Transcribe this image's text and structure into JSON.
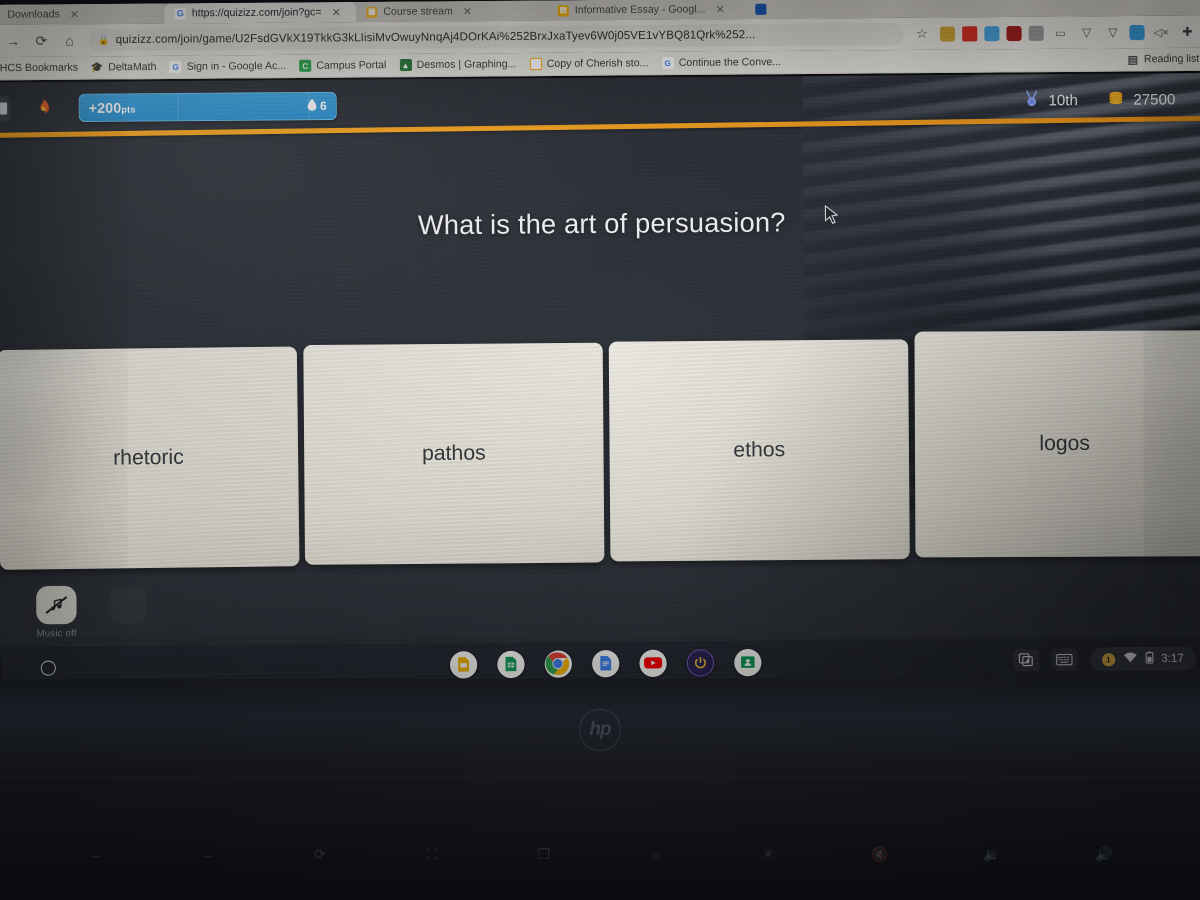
{
  "browser": {
    "tabs": [
      {
        "title": "Downloads",
        "favicon": "downloads-icon",
        "active": false
      },
      {
        "title": "https://quizizz.com/join?gc=",
        "favicon": "google-icon",
        "active": true
      },
      {
        "title": "Course stream",
        "favicon": "classroom-icon",
        "active": false
      },
      {
        "title": "Informative Essay - Googl...",
        "favicon": "docs-icon",
        "active": false
      }
    ],
    "nav": {
      "forward_icon": "arrow-right-icon",
      "reload_icon": "reload-icon",
      "home_icon": "home-icon"
    },
    "address": {
      "lock_icon": "lock-icon",
      "url": "quizizz.com/join/game/U2FsdGVkX19TkkG3kLIisiMvOwuyNnqAj4DOrKAi%252BrxJxaTyev6W0j05VE1vYBQ81Qrk%252...",
      "star_icon": "star-icon"
    },
    "extensions": [
      {
        "name": "extension-1-icon",
        "color": "#c9a227",
        "glyph": ""
      },
      {
        "name": "extension-2-icon",
        "color": "#d93025",
        "glyph": ""
      },
      {
        "name": "extension-3-icon",
        "color": "#4aa3df",
        "glyph": ""
      },
      {
        "name": "extension-4-icon",
        "color": "#a32020",
        "glyph": ""
      },
      {
        "name": "extension-5-icon",
        "color": "#8b8b8b",
        "glyph": ""
      },
      {
        "name": "extension-6-icon",
        "color": "#6e6e6e",
        "glyph": "▭"
      },
      {
        "name": "extension-7-icon",
        "color": "#6e6e6e",
        "glyph": "▽"
      },
      {
        "name": "extension-8-icon",
        "color": "#6e6e6e",
        "glyph": "▽"
      },
      {
        "name": "extension-9-icon",
        "color": "#3a9ad9",
        "glyph": ""
      },
      {
        "name": "mute-tab-icon",
        "color": "#5e5e5e",
        "glyph": "◁×"
      },
      {
        "name": "extensions-puzzle-icon",
        "color": "#4a4a4a",
        "glyph": "✚"
      }
    ],
    "bookmarks": [
      {
        "label": "HCS Bookmarks",
        "icon": "folder-icon",
        "color": "none"
      },
      {
        "label": "DeltaMath",
        "icon": "graduation-cap-icon",
        "color": "#2b2b2b"
      },
      {
        "label": "Sign in - Google Ac...",
        "icon": "google-icon",
        "color": "#ffffff"
      },
      {
        "label": "Campus Portal",
        "icon": "campus-icon",
        "color": "#2fa84f"
      },
      {
        "label": "Desmos | Graphing...",
        "icon": "desmos-icon",
        "color": "#2d7a3e"
      },
      {
        "label": "Copy of Cherish sto...",
        "icon": "slides-icon",
        "color": "#f4b400"
      },
      {
        "label": "Continue the Conve...",
        "icon": "google-icon",
        "color": "#ffffff"
      }
    ],
    "reading_list": {
      "label": "Reading list",
      "icon": "reading-list-icon"
    }
  },
  "quiz": {
    "points_bar": {
      "value": "+200",
      "unit": "pts",
      "streak_icon": "water-drop-icon",
      "streak_count": "6"
    },
    "avatar_icon": "fire-avatar-icon",
    "rank": {
      "icon": "medal-icon",
      "value": "10th"
    },
    "score": {
      "icon": "coin-stack-icon",
      "value": "27500"
    },
    "question": "What is the art of persuasion?",
    "answers": [
      {
        "label": "rhetoric"
      },
      {
        "label": "pathos"
      },
      {
        "label": "ethos"
      },
      {
        "label": "logos"
      }
    ],
    "music_toggle": {
      "icon": "music-off-icon",
      "label": "Music off"
    },
    "accent_color": "#f0a020",
    "background_color": "#2e323a"
  },
  "shelf": {
    "launcher_icon": "launcher-circle-icon",
    "apps": [
      {
        "name": "google-slides-icon",
        "color": "#f4b400",
        "glyph": "▤",
        "running": false
      },
      {
        "name": "google-sheets-icon",
        "color": "#0f9d58",
        "glyph": "▥",
        "running": false
      },
      {
        "name": "chrome-icon",
        "color": "#ffffff",
        "glyph": "",
        "running": true
      },
      {
        "name": "google-docs-icon",
        "color": "#4285f4",
        "glyph": "▤",
        "running": false
      },
      {
        "name": "youtube-icon",
        "color": "#ff0000",
        "glyph": "▶",
        "running": false
      },
      {
        "name": "power-icon",
        "color": "#5b3fa0",
        "glyph": "⏻",
        "running": false
      },
      {
        "name": "google-classroom-icon",
        "color": "#0f9d58",
        "glyph": "▦",
        "running": true
      }
    ],
    "tray": [
      {
        "name": "screen-capture-icon",
        "glyph": "❏"
      },
      {
        "name": "keyboard-icon",
        "glyph": "⌨"
      }
    ],
    "status": {
      "notification_count": "1",
      "wifi_icon": "wifi-icon",
      "battery_icon": "battery-icon",
      "time": "3:17"
    }
  },
  "device": {
    "brand_logo": "hp-logo",
    "brand_text": "hp",
    "function_keys": [
      {
        "name": "back-key",
        "glyph": "←"
      },
      {
        "name": "forward-key",
        "glyph": "→"
      },
      {
        "name": "reload-key",
        "glyph": "⟳"
      },
      {
        "name": "fullscreen-key",
        "glyph": "⛶"
      },
      {
        "name": "overview-key",
        "glyph": "❐"
      },
      {
        "name": "brightness-down-key",
        "glyph": "☼"
      },
      {
        "name": "brightness-up-key",
        "glyph": "☀"
      },
      {
        "name": "mute-key",
        "glyph": "🔇"
      },
      {
        "name": "volume-down-key",
        "glyph": "🔉"
      },
      {
        "name": "volume-up-key",
        "glyph": "🔊"
      }
    ]
  },
  "cursor": {
    "name": "mouse-pointer"
  }
}
